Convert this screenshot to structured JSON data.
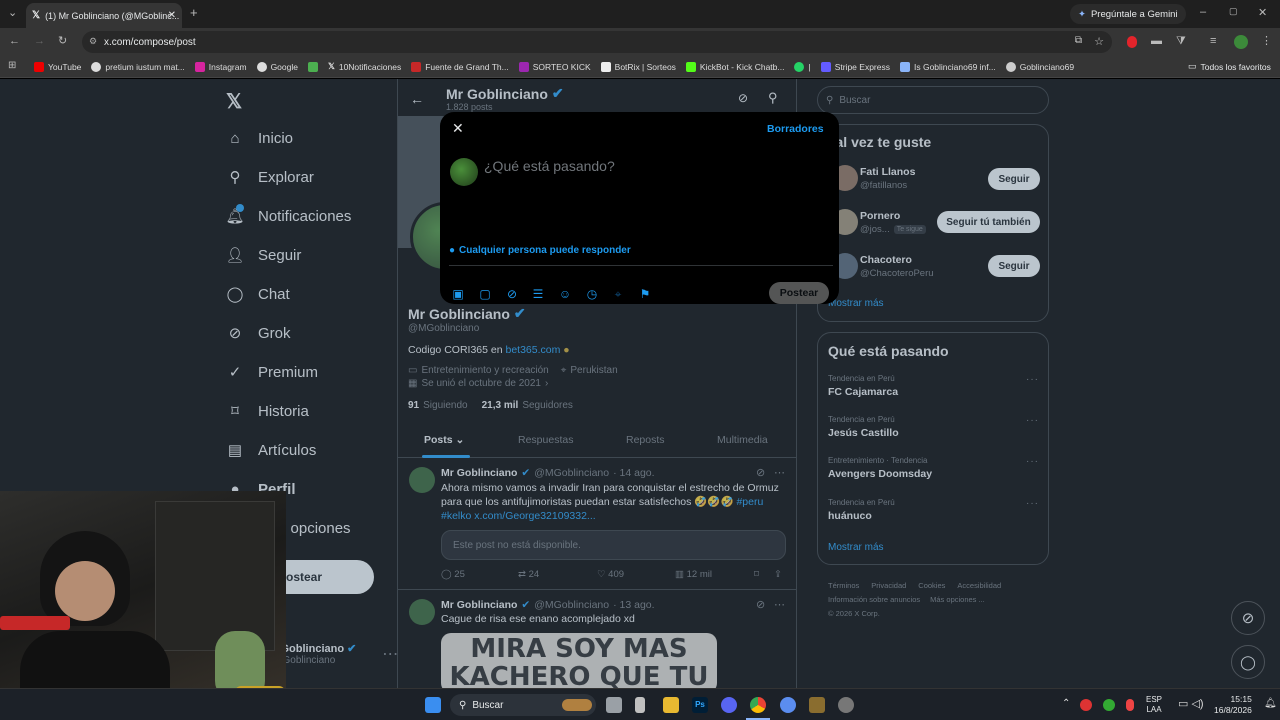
{
  "browser": {
    "tab_title": "(1) Mr Goblinciano (@MGoblinc...",
    "url": "x.com/compose/post",
    "gemini_label": "Pregúntale a Gemini",
    "bookmarks": [
      "YouTube",
      "pretium iustum mat...",
      "Instagram",
      "Google",
      "10Notificaciones",
      "Fuente de Grand Th...",
      "SORTEO KICK",
      "BotRix | Sorteos",
      "KickBot - Kick Chatb...",
      "|",
      "Stripe Express",
      "Is Goblinciano69 inf...",
      "Goblinciano69"
    ],
    "all_bookmarks": "Todos los favoritos"
  },
  "nav": {
    "items": [
      "Inicio",
      "Explorar",
      "Notificaciones",
      "Seguir",
      "Chat",
      "Grok",
      "Premium",
      "Historia",
      "Artículos",
      "Perfil",
      "Más opciones"
    ],
    "post_button": "Postear",
    "account_name": "Mr Goblinciano",
    "account_handle": "@MGoblinciano"
  },
  "profile": {
    "name": "Mr Goblinciano",
    "posts_count": "1.828 posts",
    "handle": "@MGoblinciano",
    "bio_prefix": "Codigo CORI365 en",
    "bio_link": "bet365.com",
    "category": "Entretenimiento y recreación",
    "location": "Perukistan",
    "joined": "Se unió el octubre de 2021",
    "following_count": "91",
    "following_label": "Siguiendo",
    "followers_count": "21,3 mil",
    "followers_label": "Seguidores",
    "tabs": [
      "Posts",
      "Respuestas",
      "Reposts",
      "Multimedia"
    ]
  },
  "posts": [
    {
      "name": "Mr Goblinciano",
      "handle": "@MGoblinciano",
      "date": "· 14 ago.",
      "text1": "Ahora mismo vamos a invadir Iran para conquistar el estrecho de Ormuz",
      "text2": "para que los antifujimoristas puedan estar satisfechos 🤣🤣🤣",
      "hashtag": "#peru",
      "text3": "#kelko x.com/George32109332...",
      "quote": "Este post no está disponible.",
      "replies": "25",
      "reposts": "24",
      "likes": "409",
      "views": "12 mil"
    },
    {
      "name": "Mr Goblinciano",
      "handle": "@MGoblinciano",
      "date": "· 13 ago.",
      "text1": "Cague de risa ese enano acomplejado xd",
      "image_line1": "MIRA SOY MAS",
      "image_line2": "KACHERO QUE TU"
    }
  ],
  "search_placeholder": "Buscar",
  "suggestions": {
    "title": "Tal vez te guste",
    "users": [
      {
        "name": "Fati Llanos",
        "handle": "@fatillanos",
        "button": "Seguir"
      },
      {
        "name": "Pornero",
        "handle": "@jos...",
        "badge": "Te sigue",
        "button": "Seguir tú también"
      },
      {
        "name": "Chacotero",
        "handle": "@ChacoteroPeru",
        "button": "Seguir"
      }
    ],
    "more": "Mostrar más"
  },
  "trends": {
    "title": "Qué está pasando",
    "items": [
      {
        "context": "Tendencia en Perú",
        "name": "FC Cajamarca"
      },
      {
        "context": "Tendencia en Perú",
        "name": "Jesús Castillo"
      },
      {
        "context": "Entretenimiento · Tendencia",
        "name": "Avengers Doomsday"
      },
      {
        "context": "Tendencia en Perú",
        "name": "huánuco"
      }
    ],
    "more": "Mostrar más"
  },
  "footer": {
    "line1": [
      "Términos",
      "Privacidad",
      "Cookies",
      "Accesibilidad"
    ],
    "line2": [
      "Información sobre anuncios",
      "Más opciones ..."
    ],
    "copyright": "© 2026 X Corp."
  },
  "compose": {
    "drafts": "Borradores",
    "placeholder": "¿Qué está pasando?",
    "reply_setting": "Cualquier persona puede responder",
    "post_button": "Postear"
  },
  "taskbar": {
    "search": "Buscar",
    "lang1": "ESP",
    "lang2": "LAA",
    "time": "15:15",
    "date": "16/8/2026"
  },
  "colors": {
    "accent": "#1d9bf0",
    "background": "#000000",
    "muted": "#71767b",
    "verified": "#1d9bf0"
  }
}
